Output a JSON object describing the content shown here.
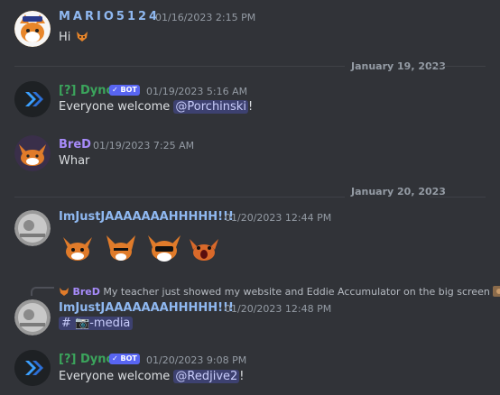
{
  "colors": {
    "background": "#313338",
    "username_blue": "#8fb8f0",
    "username_purple": "#a78bfa",
    "username_green": "#3ba55c",
    "mention_bg": "#3c4270",
    "bot_badge": "#5865f2"
  },
  "messages": [
    {
      "username": "MARIO5124",
      "timestamp": "01/16/2023 2:15 PM",
      "content": "Hi",
      "avatar_icon": "fox-sailor-avatar",
      "content_emoji": "fox-emoji"
    },
    {
      "username": "[?] Dyno",
      "bot_badge": "✓ BOT",
      "timestamp": "01/19/2023 5:16 AM",
      "content_prefix": "Everyone welcome ",
      "mention": "@Porchinski",
      "content_suffix": "!",
      "avatar_icon": "dyno-logo-avatar"
    },
    {
      "username": "BreD",
      "timestamp": "01/19/2023 7:25 AM",
      "content": "Whar",
      "avatar_icon": "fox-avatar"
    },
    {
      "username": "ImJustJAAAAAAAHHHHH!!!",
      "timestamp": "01/20/2023 12:44 PM",
      "avatar_icon": "coin-avatar",
      "stickers": [
        "fox-sticker-1",
        "fox-sticker-2",
        "fox-sticker-3",
        "fox-sticker-4"
      ]
    },
    {
      "reply": {
        "username": "BreD",
        "text": "My teacher just showed my website and Eddie Accumulator on the big screen"
      },
      "username": "ImJustJAAAAAAAHHHHH!!!",
      "timestamp": "01/20/2023 12:48 PM",
      "channel_link": "# 📷-media",
      "avatar_icon": "coin-avatar"
    },
    {
      "username": "[?] Dyno",
      "bot_badge": "✓ BOT",
      "timestamp": "01/20/2023 9:08 PM",
      "content_prefix": "Everyone welcome ",
      "mention": "@Redjive2",
      "content_suffix": "!",
      "avatar_icon": "dyno-logo-avatar"
    }
  ],
  "dividers": [
    {
      "label": "January 19, 2023"
    },
    {
      "label": "January 20, 2023"
    }
  ]
}
